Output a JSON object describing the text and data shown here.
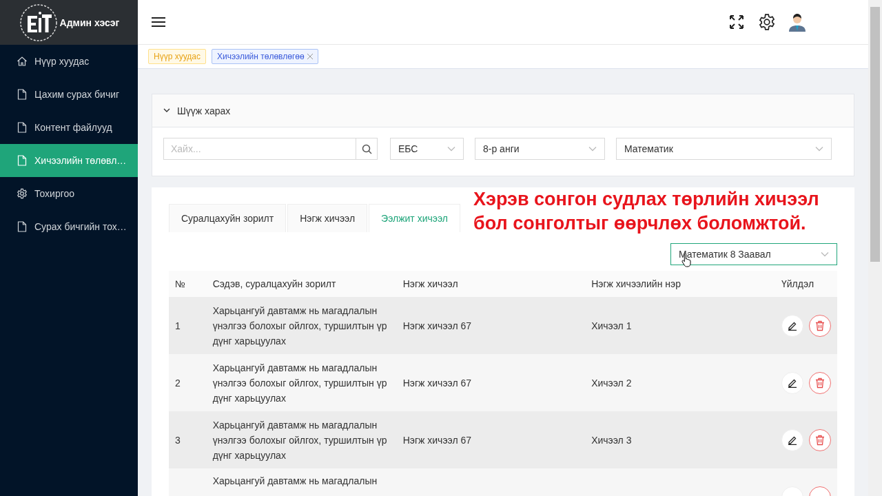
{
  "brand": {
    "title": "Админ хэсэг"
  },
  "sidebar": {
    "items": [
      {
        "label": "Нүүр хуудас",
        "kind": "home",
        "selected": false
      },
      {
        "label": "Цахим сурах бичиг",
        "kind": "file",
        "selected": false
      },
      {
        "label": "Контент файлууд",
        "kind": "file",
        "selected": false
      },
      {
        "label": "Хичээлийн төлөвл…",
        "kind": "file",
        "selected": true
      },
      {
        "label": "Тохиргоо",
        "kind": "settings",
        "selected": false
      },
      {
        "label": "Сурах бичгийн тох…",
        "kind": "file",
        "selected": false
      }
    ]
  },
  "tags": [
    {
      "label": "Нүүр хуудас",
      "selected": false,
      "closable": false
    },
    {
      "label": "Хичээлийн төлөвлөгөө",
      "selected": true,
      "closable": true
    }
  ],
  "filter": {
    "title": "Шүүж харах",
    "expanded": true,
    "search": {
      "placeholder": "Хайх..."
    },
    "selects": [
      {
        "value": "ЕБС"
      },
      {
        "value": "8-р анги"
      },
      {
        "value": "Математик"
      }
    ]
  },
  "tabs": [
    {
      "label": "Суралцахуйн зорилт",
      "selected": false
    },
    {
      "label": "Нэгж хичээл",
      "selected": false
    },
    {
      "label": "Ээлжит хичээл",
      "selected": true
    }
  ],
  "annotation": "Хэрэв сонгон судлах төрлийн хичээл бол сонголтыг өөрчлөх боломжтой.",
  "plan_select": {
    "value": "Математик 8 Заавал"
  },
  "table": {
    "columns": [
      "№",
      "Сэдэв, суралцахуйн зорилт",
      "Нэгж хичээл",
      "Нэгж хичээлийн нэр",
      "Үйлдэл"
    ],
    "rows": [
      {
        "number": "1",
        "topic": "Харьцангуй давтамж нь магадлалын үнэлгээ болохыг ойлгох, туршилтын үр дүнг харьцуулах",
        "unit": "Нэгж хичээл 67",
        "name": "Хичээл 1"
      },
      {
        "number": "2",
        "topic": "Харьцангуй давтамж нь магадлалын үнэлгээ болохыг ойлгох, туршилтын үр дүнг харьцуулах",
        "unit": "Нэгж хичээл 67",
        "name": "Хичээл 2"
      },
      {
        "number": "3",
        "topic": "Харьцангуй давтамж нь магадлалын үнэлгээ болохыг ойлгох, туршилтын үр дүнг харьцуулах",
        "unit": "Нэгж хичээл 67",
        "name": "Хичээл 3"
      },
      {
        "topic": "Харьцангуй давтамж нь магадлалын"
      }
    ]
  }
}
